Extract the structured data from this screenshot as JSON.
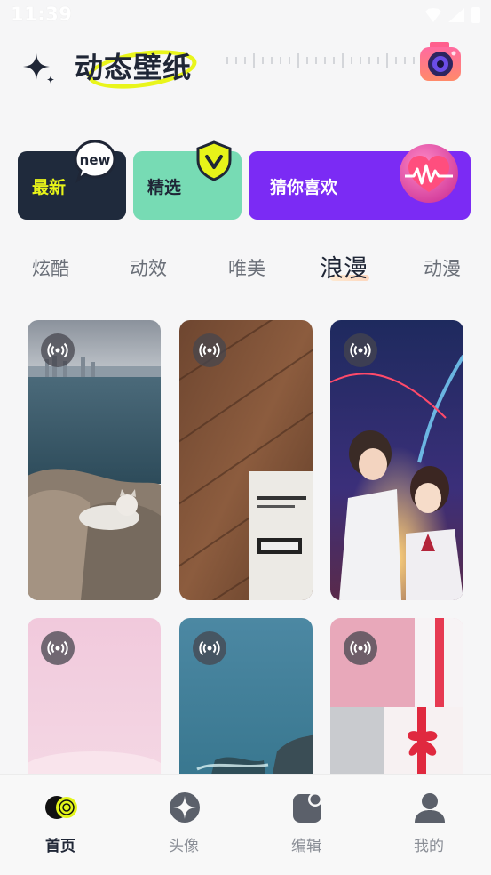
{
  "status_bar": {
    "time": "11:39"
  },
  "header": {
    "title": "动态壁纸",
    "icons": [
      "sparkle-icon",
      "camera-icon"
    ]
  },
  "categories": [
    {
      "label": "最新",
      "badge": "new"
    },
    {
      "label": "精选",
      "badge": "v"
    },
    {
      "label": "猜你喜欢",
      "badge": "heart"
    }
  ],
  "tabs": [
    {
      "label": "炫酷",
      "active": false
    },
    {
      "label": "动效",
      "active": false
    },
    {
      "label": "唯美",
      "active": false
    },
    {
      "label": "浪漫",
      "active": true
    },
    {
      "label": "动漫",
      "active": false
    }
  ],
  "wallpapers": [
    {
      "subject": "cat-on-rocks-seaside",
      "live": true
    },
    {
      "subject": "wood-with-package",
      "live": true
    },
    {
      "subject": "anime-couple-comet",
      "live": true
    },
    {
      "subject": "pink-soft-gradient",
      "live": true
    },
    {
      "subject": "teal-ocean-coast",
      "live": true
    },
    {
      "subject": "pink-gift-boxes",
      "live": true
    }
  ],
  "bottom_nav": [
    {
      "label": "首页",
      "icon": "home-icon",
      "active": true
    },
    {
      "label": "头像",
      "icon": "avatar-compass-icon",
      "active": false
    },
    {
      "label": "编辑",
      "icon": "edit-icon",
      "active": false
    },
    {
      "label": "我的",
      "icon": "profile-icon",
      "active": false
    }
  ],
  "colors": {
    "accent_yellow": "#e7f319",
    "purple": "#7b2bf4",
    "mint": "#77dbb4",
    "navy": "#1f2a3c"
  }
}
